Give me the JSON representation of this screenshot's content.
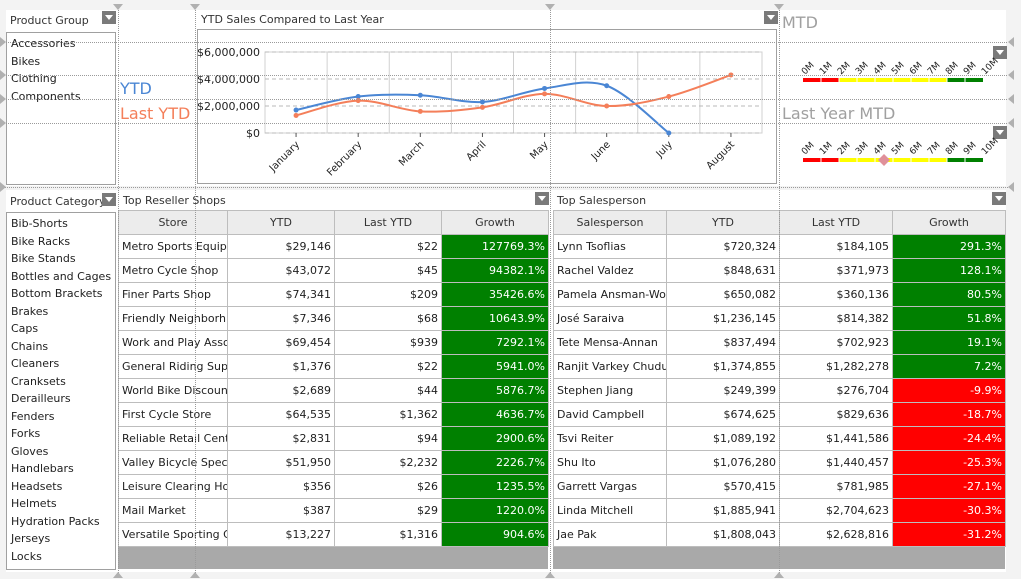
{
  "product_group": {
    "title": "Product Group",
    "items": [
      "Accessories",
      "Bikes",
      "Clothing",
      "Components"
    ]
  },
  "product_category": {
    "title": "Product Category",
    "items": [
      "Bib-Shorts",
      "Bike Racks",
      "Bike Stands",
      "Bottles and Cages",
      "Bottom Brackets",
      "Brakes",
      "Caps",
      "Chains",
      "Cleaners",
      "Cranksets",
      "Derailleurs",
      "Fenders",
      "Forks",
      "Gloves",
      "Handlebars",
      "Headsets",
      "Helmets",
      "Hydration Packs",
      "Jerseys",
      "Locks"
    ]
  },
  "legend": {
    "ytd": "YTD",
    "last_ytd": "Last YTD",
    "ytd_color": "#4a86d4",
    "last_ytd_color": "#f47f5a"
  },
  "chart_data": {
    "type": "line",
    "title": "YTD Sales Compared to Last Year",
    "categories": [
      "January",
      "February",
      "March",
      "April",
      "May",
      "June",
      "July",
      "August"
    ],
    "series": [
      {
        "name": "YTD",
        "color": "#4a86d4",
        "values": [
          1700000,
          2700000,
          2800000,
          2300000,
          3300000,
          3500000,
          0,
          null
        ]
      },
      {
        "name": "Last YTD",
        "color": "#f47f5a",
        "values": [
          1300000,
          2400000,
          1600000,
          1900000,
          2900000,
          2000000,
          2700000,
          4300000
        ]
      }
    ],
    "yticks": [
      "$0",
      "$2,000,000",
      "$4,000,000",
      "$6,000,000"
    ],
    "ytick_values": [
      0,
      2000000,
      4000000,
      6000000
    ],
    "ylim": [
      0,
      6000000
    ],
    "xlabel": "",
    "ylabel": "",
    "grid": true,
    "legend": "left"
  },
  "gauges": {
    "mtd": {
      "title": "MTD",
      "ticks": [
        "0M",
        "1M",
        "2M",
        "3M",
        "4M",
        "5M",
        "6M",
        "7M",
        "8M",
        "9M",
        "10M"
      ],
      "range": [
        0,
        10
      ],
      "bands": [
        {
          "from": 0,
          "to": 2,
          "color": "#ff0000"
        },
        {
          "from": 2,
          "to": 8,
          "color": "#ffff00"
        },
        {
          "from": 8,
          "to": 10,
          "color": "#008000"
        }
      ],
      "value": null
    },
    "last_year_mtd": {
      "title": "Last Year MTD",
      "ticks": [
        "0M",
        "1M",
        "2M",
        "3M",
        "4M",
        "5M",
        "6M",
        "7M",
        "8M",
        "9M",
        "10M"
      ],
      "range": [
        0,
        10
      ],
      "bands": [
        {
          "from": 0,
          "to": 2,
          "color": "#ff0000"
        },
        {
          "from": 2,
          "to": 8,
          "color": "#ffff00"
        },
        {
          "from": 8,
          "to": 10,
          "color": "#008000"
        }
      ],
      "value": 4.5,
      "marker_color": "#e0909a"
    }
  },
  "reseller": {
    "title": "Top Reseller Shops",
    "columns": [
      "Store",
      "YTD",
      "Last YTD",
      "Growth"
    ],
    "rows": [
      [
        "Metro Sports Equip...",
        "$29,146",
        "$22",
        "127769.3%"
      ],
      [
        "Metro Cycle Shop",
        "$43,072",
        "$45",
        "94382.1%"
      ],
      [
        "Finer Parts Shop",
        "$74,341",
        "$209",
        "35426.6%"
      ],
      [
        "Friendly Neighborh...",
        "$7,346",
        "$68",
        "10643.9%"
      ],
      [
        "Work and Play Asso...",
        "$69,454",
        "$939",
        "7292.1%"
      ],
      [
        "General Riding Sup...",
        "$1,376",
        "$22",
        "5941.0%"
      ],
      [
        "World Bike Discount...",
        "$2,689",
        "$44",
        "5876.7%"
      ],
      [
        "First Cycle Store",
        "$64,535",
        "$1,362",
        "4636.7%"
      ],
      [
        "Reliable Retail Cent...",
        "$2,831",
        "$94",
        "2900.6%"
      ],
      [
        "Valley Bicycle Specia...",
        "$51,950",
        "$2,232",
        "2226.7%"
      ],
      [
        "Leisure Clearing Ho...",
        "$356",
        "$26",
        "1235.5%"
      ],
      [
        "Mail Market",
        "$387",
        "$29",
        "1220.0%"
      ],
      [
        "Versatile Sporting G...",
        "$13,227",
        "$1,316",
        "904.6%"
      ]
    ]
  },
  "salesperson": {
    "title": "Top Salesperson",
    "columns": [
      "Salesperson",
      "YTD",
      "Last YTD",
      "Growth"
    ],
    "rows": [
      [
        "Lynn Tsoflias",
        "$720,324",
        "$184,105",
        "291.3%"
      ],
      [
        "Rachel Valdez",
        "$848,631",
        "$371,973",
        "128.1%"
      ],
      [
        "Pamela Ansman-Wolf...",
        "$650,082",
        "$360,136",
        "80.5%"
      ],
      [
        "José Saraiva",
        "$1,236,145",
        "$814,382",
        "51.8%"
      ],
      [
        "Tete Mensa-Annan",
        "$837,494",
        "$702,923",
        "19.1%"
      ],
      [
        "Ranjit Varkey Chuduk...",
        "$1,374,855",
        "$1,282,278",
        "7.2%"
      ],
      [
        "Stephen Jiang",
        "$249,399",
        "$276,704",
        "-9.9%"
      ],
      [
        "David Campbell",
        "$674,625",
        "$829,636",
        "-18.7%"
      ],
      [
        "Tsvi Reiter",
        "$1,089,192",
        "$1,441,586",
        "-24.4%"
      ],
      [
        "Shu Ito",
        "$1,076,280",
        "$1,440,457",
        "-25.3%"
      ],
      [
        "Garrett Vargas",
        "$570,415",
        "$781,985",
        "-27.1%"
      ],
      [
        "Linda Mitchell",
        "$1,885,941",
        "$2,704,623",
        "-30.3%"
      ],
      [
        "Jae Pak",
        "$1,808,043",
        "$2,628,816",
        "-31.2%"
      ]
    ]
  },
  "colors": {
    "positive": "#008000",
    "negative": "#ff0000"
  }
}
